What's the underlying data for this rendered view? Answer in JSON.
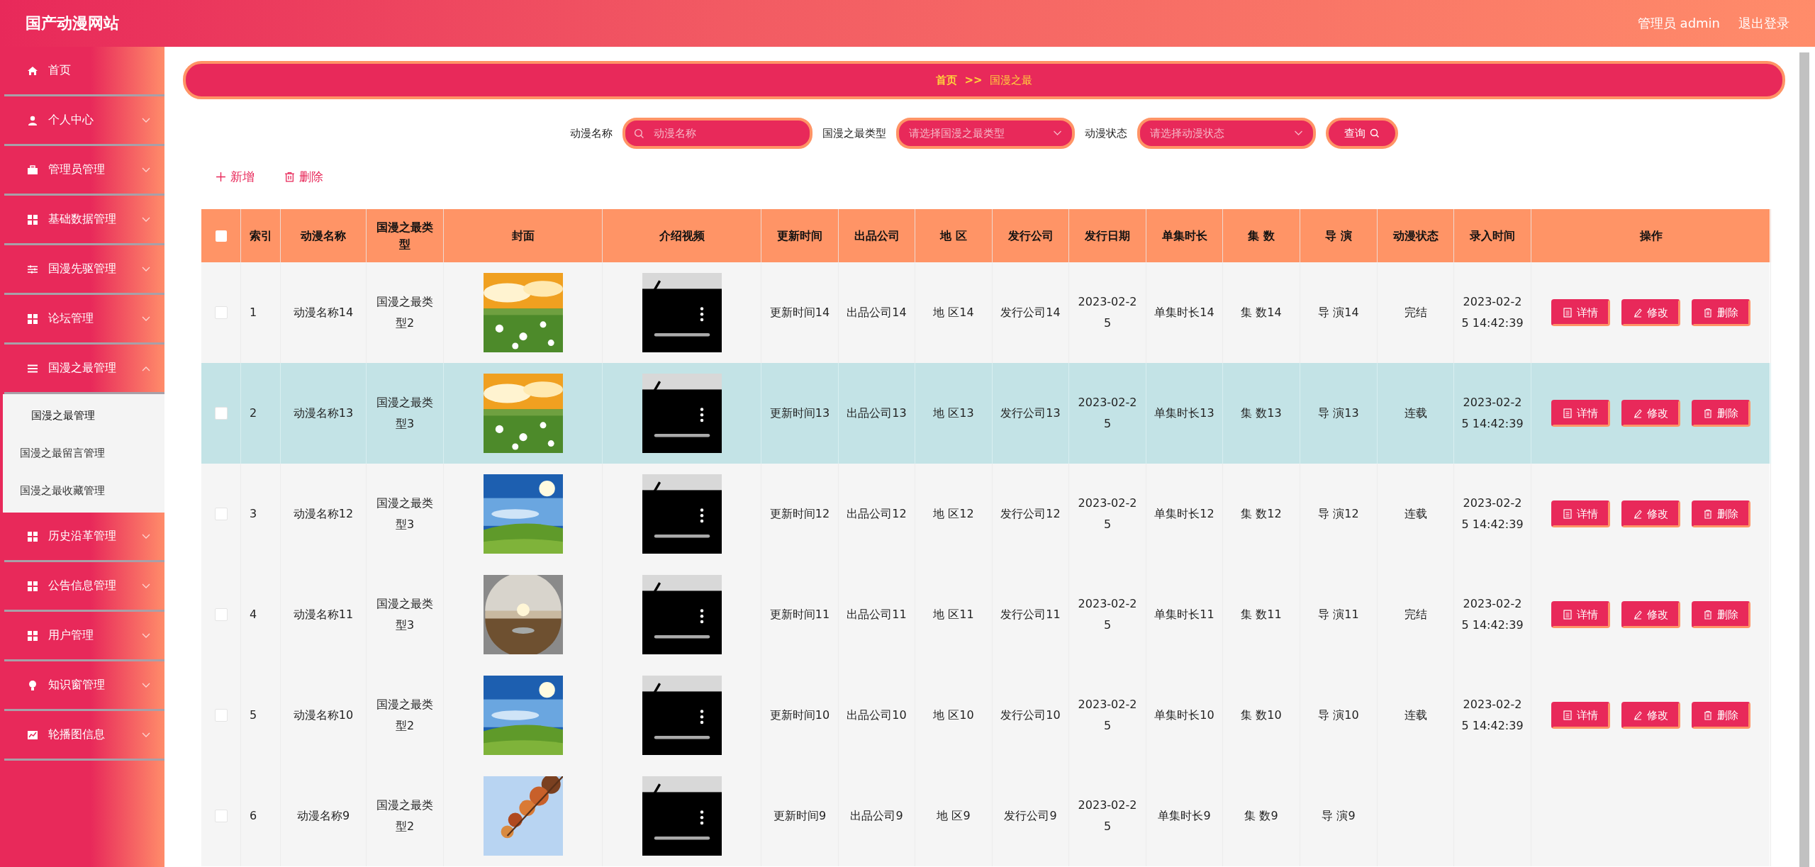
{
  "header": {
    "title": "国产动漫网站",
    "user": "管理员 admin",
    "logout": "退出登录"
  },
  "sidebar": {
    "items": [
      {
        "label": "首页",
        "expandable": false
      },
      {
        "label": "个人中心",
        "expandable": true,
        "expanded": false
      },
      {
        "label": "管理员管理",
        "expandable": true,
        "expanded": false
      },
      {
        "label": "基础数据管理",
        "expandable": true,
        "expanded": false
      },
      {
        "label": "国漫先驱管理",
        "expandable": true,
        "expanded": false
      },
      {
        "label": "论坛管理",
        "expandable": true,
        "expanded": false
      },
      {
        "label": "国漫之最管理",
        "expandable": true,
        "expanded": true,
        "children": [
          {
            "label": "国漫之最管理",
            "selected": true
          },
          {
            "label": "国漫之最留言管理",
            "selected": false
          },
          {
            "label": "国漫之最收藏管理",
            "selected": false
          }
        ]
      },
      {
        "label": "历史沿革管理",
        "expandable": true,
        "expanded": false
      },
      {
        "label": "公告信息管理",
        "expandable": true,
        "expanded": false
      },
      {
        "label": "用户管理",
        "expandable": true,
        "expanded": false
      },
      {
        "label": "知识窗管理",
        "expandable": true,
        "expanded": false
      },
      {
        "label": "轮播图信息",
        "expandable": true,
        "expanded": false
      }
    ]
  },
  "breadcrumb": {
    "home": "首页",
    "separator": ">>",
    "current": "国漫之最"
  },
  "search": {
    "fields": [
      {
        "label": "动漫名称",
        "kind": "input",
        "placeholder": "动漫名称"
      },
      {
        "label": "国漫之最类型",
        "kind": "select",
        "placeholder": "请选择国漫之最类型"
      },
      {
        "label": "动漫状态",
        "kind": "select",
        "placeholder": "请选择动漫状态"
      }
    ],
    "button": "查询"
  },
  "actions": [
    {
      "label": "新增",
      "kind": "add"
    },
    {
      "label": "删除",
      "kind": "delete"
    }
  ],
  "table": {
    "all_checked": false,
    "columns": [
      {
        "label": "索引",
        "kind": "text"
      },
      {
        "label": "动漫名称",
        "kind": "text"
      },
      {
        "label": "国漫之最类型",
        "kind": "text"
      },
      {
        "label": "封面",
        "kind": "picture"
      },
      {
        "label": "介绍视频",
        "kind": "video"
      },
      {
        "label": "更新时间",
        "kind": "text"
      },
      {
        "label": "出品公司",
        "kind": "text"
      },
      {
        "label": "地 区",
        "kind": "text"
      },
      {
        "label": "发行公司",
        "kind": "text"
      },
      {
        "label": "发行日期",
        "kind": "text"
      },
      {
        "label": "单集时长",
        "kind": "text"
      },
      {
        "label": "集 数",
        "kind": "text"
      },
      {
        "label": "导 演",
        "kind": "text"
      },
      {
        "label": "动漫状态",
        "kind": "text"
      },
      {
        "label": "录入时间",
        "kind": "text"
      },
      {
        "label": "操作",
        "kind": "actions"
      }
    ],
    "rows": [
      {
        "selected": false,
        "checked": false,
        "cells": [
          "1",
          "动漫名称14",
          "国漫之最类型2",
          "",
          "",
          "更新时间14",
          "出品公司14",
          "地 区14",
          "发行公司14",
          "2023-02-25",
          "单集时长14",
          "集 数14",
          "导 演14",
          "完结",
          "2023-02-25 14:42:39"
        ],
        "actions": [
          {
            "label": "详情",
            "kind": "detail"
          },
          {
            "label": "修改",
            "kind": "edit"
          },
          {
            "label": "删除",
            "kind": "delete"
          }
        ]
      },
      {
        "selected": true,
        "checked": false,
        "cells": [
          "2",
          "动漫名称13",
          "国漫之最类型3",
          "",
          "",
          "更新时间13",
          "出品公司13",
          "地 区13",
          "发行公司13",
          "2023-02-25",
          "单集时长13",
          "集 数13",
          "导 演13",
          "连载",
          "2023-02-25 14:42:39"
        ],
        "actions": [
          {
            "label": "详情",
            "kind": "detail"
          },
          {
            "label": "修改",
            "kind": "edit"
          },
          {
            "label": "删除",
            "kind": "delete"
          }
        ]
      },
      {
        "selected": false,
        "checked": false,
        "cells": [
          "3",
          "动漫名称12",
          "国漫之最类型3",
          "",
          "",
          "更新时间12",
          "出品公司12",
          "地 区12",
          "发行公司12",
          "2023-02-25",
          "单集时长12",
          "集 数12",
          "导 演12",
          "连载",
          "2023-02-25 14:42:39"
        ],
        "actions": [
          {
            "label": "详情",
            "kind": "detail"
          },
          {
            "label": "修改",
            "kind": "edit"
          },
          {
            "label": "删除",
            "kind": "delete"
          }
        ]
      },
      {
        "selected": false,
        "checked": false,
        "cells": [
          "4",
          "动漫名称11",
          "国漫之最类型3",
          "",
          "",
          "更新时间11",
          "出品公司11",
          "地 区11",
          "发行公司11",
          "2023-02-25",
          "单集时长11",
          "集 数11",
          "导 演11",
          "完结",
          "2023-02-25 14:42:39"
        ],
        "actions": [
          {
            "label": "详情",
            "kind": "detail"
          },
          {
            "label": "修改",
            "kind": "edit"
          },
          {
            "label": "删除",
            "kind": "delete"
          }
        ]
      },
      {
        "selected": false,
        "checked": false,
        "cells": [
          "5",
          "动漫名称10",
          "国漫之最类型2",
          "",
          "",
          "更新时间10",
          "出品公司10",
          "地 区10",
          "发行公司10",
          "2023-02-25",
          "单集时长10",
          "集 数10",
          "导 演10",
          "连载",
          "2023-02-25 14:42:39"
        ],
        "actions": [
          {
            "label": "详情",
            "kind": "detail"
          },
          {
            "label": "修改",
            "kind": "edit"
          },
          {
            "label": "删除",
            "kind": "delete"
          }
        ]
      },
      {
        "selected": false,
        "checked": false,
        "cells": [
          "6",
          "动漫名称9",
          "国漫之最类型2",
          "",
          "",
          "更新时间9",
          "出品公司9",
          "地 区9",
          "发行公司9",
          "2023-02-25",
          "单集时长9",
          "集 数9",
          "导 演9"
        ]
      }
    ]
  }
}
